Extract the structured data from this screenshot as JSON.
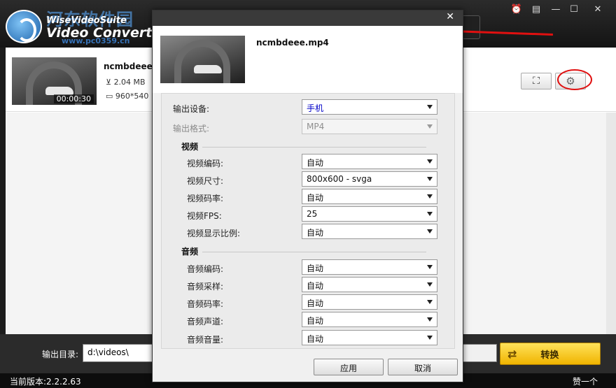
{
  "app": {
    "watermark": "河东软件园",
    "watermark_url": "www.pc0359.cn",
    "brand_top": "WiseVideoSuite",
    "brand_main": "Video Converter",
    "window_controls": [
      "alarm-icon",
      "menu-icon",
      "minimize-icon",
      "maximize-icon",
      "close-icon"
    ]
  },
  "file": {
    "name": "ncmbdeee.mp4",
    "name_truncated": "ncmbdeee.r",
    "duration": "00:00:30",
    "size": "2.04 MB",
    "resolution": "960*540"
  },
  "output": {
    "dir_label": "输出目录:",
    "dir_value": "d:\\videos\\",
    "convert_label": "转换"
  },
  "status": {
    "version": "当前版本:2.2.2.63",
    "like": "赞一个"
  },
  "dialog": {
    "filename": "ncmbdeee.mp4",
    "device": {
      "label": "输出设备:",
      "value": "手机"
    },
    "format": {
      "label": "输出格式:",
      "value": "MP4"
    },
    "video_section": "视频",
    "video": [
      {
        "label": "视频编码:",
        "value": "自动"
      },
      {
        "label": "视频尺寸:",
        "value": "800x600 - svga"
      },
      {
        "label": "视频码率:",
        "value": "自动"
      },
      {
        "label": "视频FPS:",
        "value": "25"
      },
      {
        "label": "视频显示比例:",
        "value": "自动"
      }
    ],
    "audio_section": "音频",
    "audio": [
      {
        "label": "音频编码:",
        "value": "自动"
      },
      {
        "label": "音频采样:",
        "value": "自动"
      },
      {
        "label": "音频码率:",
        "value": "自动"
      },
      {
        "label": "音频声道:",
        "value": "自动"
      },
      {
        "label": "音频音量:",
        "value": "自动"
      }
    ],
    "apply_label": "应用",
    "cancel_label": "取消"
  },
  "colors": {
    "highlight_ring": "#e01010",
    "convert_button": "#f0b400",
    "selected_value": "#0000c8"
  }
}
